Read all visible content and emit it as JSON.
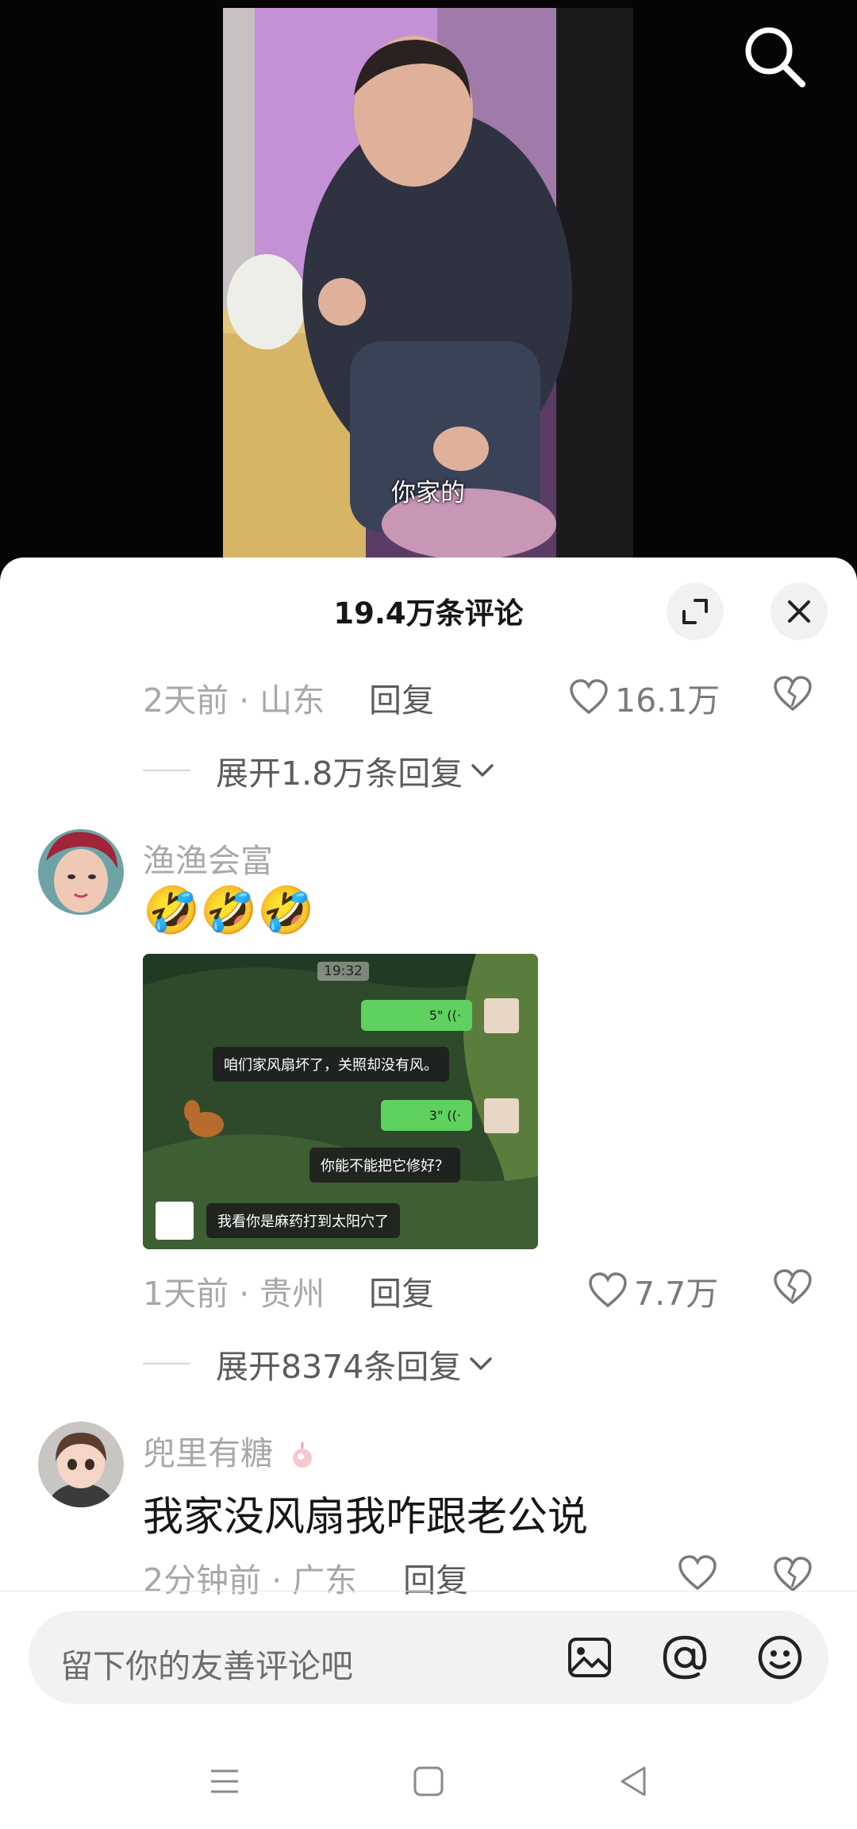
{
  "video": {
    "subtitle": "你家的"
  },
  "header": {
    "title": "19.4万条评论"
  },
  "comments": [
    {
      "meta": "2天前 · 山东",
      "reply_label": "回复",
      "likes": "16.1万",
      "expand_label": "展开1.8万条回复"
    },
    {
      "username": "渔渔会富",
      "emoji": "🤣🤣🤣",
      "image": {
        "time": "19:32",
        "voice1": "5\"",
        "text1": "咱们家风扇坏了，关照却没有风。",
        "voice2": "3\"",
        "text2": "你能不能把它修好？",
        "text3": "我看你是麻药打到太阳穴了"
      },
      "meta": "1天前 · 贵州",
      "reply_label": "回复",
      "likes": "7.7万",
      "expand_label": "展开8374条回复"
    },
    {
      "username": "兜里有糖",
      "text": "我家没风扇我咋跟老公说",
      "meta": "2分钟前 · 广东",
      "reply_label": "回复"
    }
  ],
  "input": {
    "placeholder": "留下你的友善评论吧"
  },
  "icons": {
    "search": "search-icon",
    "expand": "expand-icon",
    "close": "close-icon",
    "like": "heart-icon",
    "dislike": "broken-heart-icon",
    "image": "image-icon",
    "mention": "at-icon",
    "emoji": "emoji-icon",
    "nav_menu": "menu-icon",
    "nav_home": "home-icon",
    "nav_back": "back-icon"
  }
}
